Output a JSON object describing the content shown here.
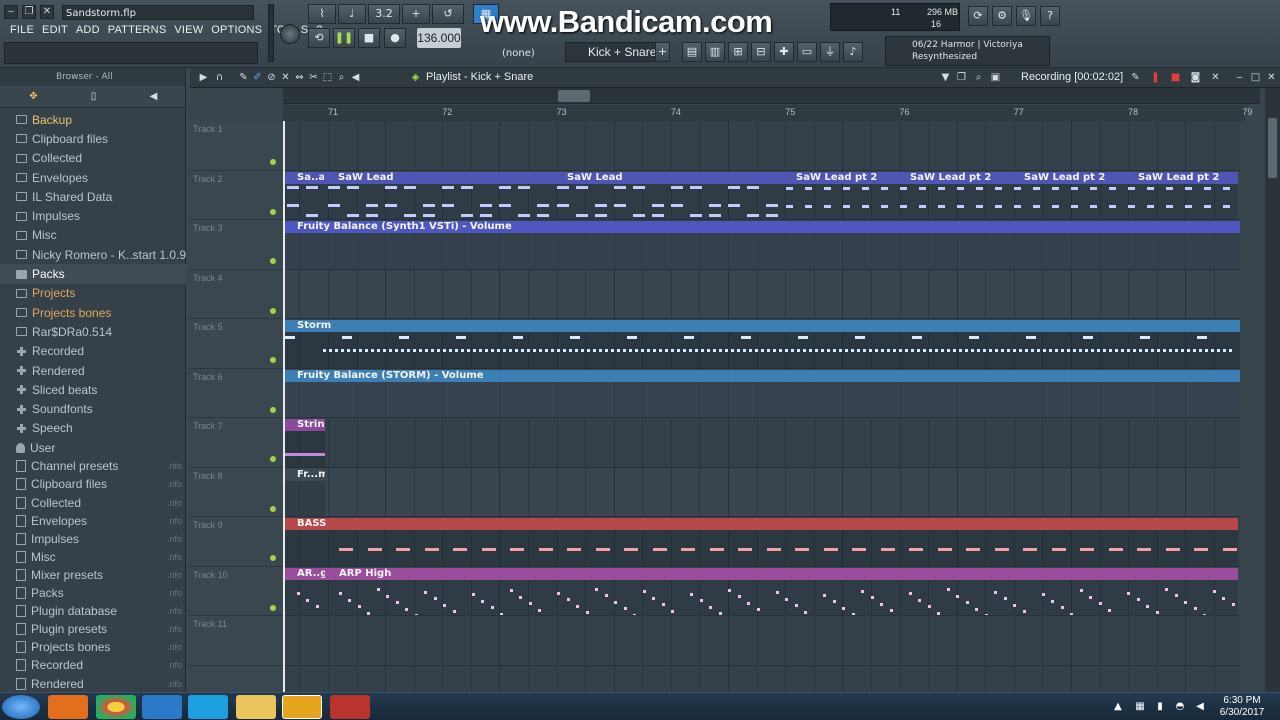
{
  "window": {
    "file_title": "Sandstorm.flp",
    "minimize": "‒",
    "restore": "❐",
    "close": "✕"
  },
  "menu": [
    "FILE",
    "EDIT",
    "ADD",
    "PATTERNS",
    "VIEW",
    "OPTIONS",
    "TOOLS",
    "?"
  ],
  "transport": {
    "tempo": "136.000",
    "snap_value": "3.2",
    "pattern_name": "Kick + Snare",
    "channel_target": "(none)",
    "watermark": "www.Bandicam.com"
  },
  "monitor": {
    "cpu_value": "11",
    "memory": "296 MB",
    "polyphony": "16"
  },
  "hint_panel": {
    "line1": "06/22  Harmor | Victoriya",
    "line2": "Resynthesized"
  },
  "browser": {
    "header": "Browser - All",
    "items": [
      {
        "label": "Backup",
        "icon": "folder-icon",
        "style": "yellow"
      },
      {
        "label": "Clipboard files",
        "icon": "folder-icon"
      },
      {
        "label": "Collected",
        "icon": "folder-icon"
      },
      {
        "label": "Envelopes",
        "icon": "folder-icon"
      },
      {
        "label": "IL Shared Data",
        "icon": "folder-icon"
      },
      {
        "label": "Impulses",
        "icon": "folder-icon"
      },
      {
        "label": "Misc",
        "icon": "folder-icon"
      },
      {
        "label": "Nicky Romero - K..start 1.0.9 Demo",
        "icon": "folder-icon"
      },
      {
        "label": "Packs",
        "icon": "packs-icon",
        "selected": true
      },
      {
        "label": "Projects",
        "icon": "folder-icon",
        "style": "orange"
      },
      {
        "label": "Projects bones",
        "icon": "folder-icon",
        "style": "orange"
      },
      {
        "label": "Rar$DRa0.514",
        "icon": "folder-icon"
      },
      {
        "label": "Recorded",
        "icon": "plus-icon"
      },
      {
        "label": "Rendered",
        "icon": "plus-icon"
      },
      {
        "label": "Sliced beats",
        "icon": "plus-icon"
      },
      {
        "label": "Soundfonts",
        "icon": "plus-icon"
      },
      {
        "label": "Speech",
        "icon": "plus-icon"
      },
      {
        "label": "User",
        "icon": "user-icon"
      }
    ],
    "nfo_items": [
      "Channel presets",
      "Clipboard files",
      "Collected",
      "Envelopes",
      "Impulses",
      "Misc",
      "Mixer presets",
      "Packs",
      "Plugin database",
      "Plugin presets",
      "Projects bones",
      "Recorded",
      "Rendered"
    ],
    "nfo_label": ".nfo"
  },
  "playlist": {
    "title": "Playlist - Kick + Snare",
    "recording": "Recording [00:02:02]",
    "bars": [
      "71",
      "72",
      "73",
      "74",
      "75",
      "76",
      "77",
      "78",
      "79"
    ],
    "track_labels": [
      "Track 1",
      "Track 2",
      "Track 3",
      "Track 4",
      "Track 5",
      "Track 6",
      "Track 7",
      "Track 8",
      "Track 9",
      "Track 10",
      "Track 11"
    ],
    "clips": {
      "saw_short": "Sa..ad",
      "saw_lead": "SaW Lead",
      "saw_lead_2": "SaW Lead",
      "saw_pt2_a": "SaW Lead pt 2",
      "saw_pt2_b": "SaW Lead pt 2",
      "saw_pt2_c": "SaW Lead pt 2",
      "saw_pt2_d": "SaW Lead pt 2",
      "balance_synth": "Fruity Balance (Synth1 VSTi) - Volume",
      "storm": "Storm",
      "balance_storm": "Fruity Balance (STORM) - Volume",
      "strings": "Strings",
      "frame": "Fr...me",
      "bass": "BASS",
      "arp_short": "AR..gh",
      "arp_high": "ARP High"
    },
    "colors": {
      "saw": "#4f55b4",
      "balance": "#4e56c0",
      "storm": "#3c7fb4",
      "strings": "#8a4a9c",
      "bass": "#b8474a",
      "arp": "#9a4d9a",
      "note_saw": "#c4c9ff",
      "note_bass": "#f4a1a4",
      "note_arp": "#f0c1f0",
      "note_storm": "#d9ecff"
    }
  },
  "taskbar": {
    "time": "6:30 PM",
    "date": "6/30/2017",
    "apps": [
      "start-orb",
      "media-player",
      "chrome",
      "internet-explorer",
      "skype",
      "file-explorer",
      "fl-studio",
      "bandicam"
    ]
  }
}
